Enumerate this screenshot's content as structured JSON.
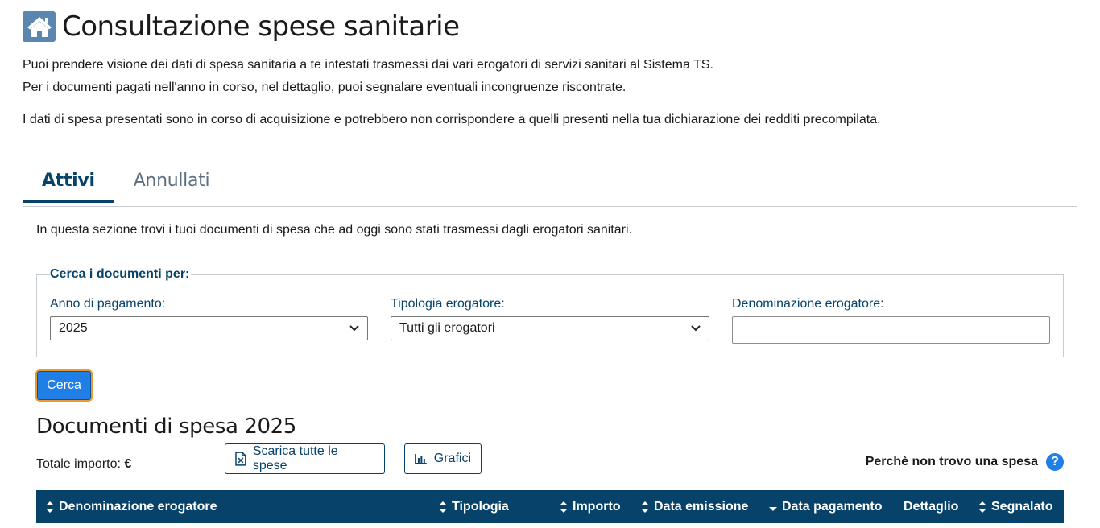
{
  "header": {
    "title": "Consultazione spese sanitarie",
    "intro_lines": [
      "Puoi prendere visione dei dati di spesa sanitaria a te intestati trasmessi dai vari erogatori di servizi sanitari al Sistema TS.",
      "Per i documenti pagati nell'anno in corso, nel dettaglio, puoi segnalare eventuali incongruenze riscontrate.",
      "I dati di spesa presentati sono in corso di acquisizione e potrebbero non corrispondere a quelli presenti nella tua dichiarazione dei redditi precompilata."
    ]
  },
  "tabs": [
    {
      "label": "Attivi",
      "active": true
    },
    {
      "label": "Annullati",
      "active": false
    }
  ],
  "panel": {
    "description": "In questa sezione trovi i tuoi documenti di spesa che ad oggi sono stati trasmessi dagli erogatori sanitari."
  },
  "search": {
    "legend": "Cerca i documenti per:",
    "anno_label": "Anno di pagamento:",
    "anno_value": "2025",
    "tipologia_label": "Tipologia erogatore:",
    "tipologia_value": "Tutti gli erogatori",
    "denominazione_label": "Denominazione erogatore:",
    "denominazione_value": "",
    "submit_label": "Cerca"
  },
  "results": {
    "title": "Documenti di spesa 2025",
    "totale_label": "Totale importo:",
    "totale_currency": "€",
    "download_label": "Scarica tutte le spese",
    "charts_label": "Grafici",
    "help_label": "Perchè non trovo una spesa",
    "help_icon": "?"
  },
  "table": {
    "columns": [
      {
        "label": "Denominazione erogatore",
        "sort": "both"
      },
      {
        "label": "Tipologia",
        "sort": "both"
      },
      {
        "label": "Importo",
        "sort": "both"
      },
      {
        "label": "Data emissione",
        "sort": "both"
      },
      {
        "label": "Data pagamento",
        "sort": "desc"
      },
      {
        "label": "Dettaglio",
        "sort": "none"
      },
      {
        "label": "Segnalato",
        "sort": "both"
      }
    ]
  },
  "colors": {
    "primary": "#06426a",
    "accent": "#1f7fe6",
    "home_icon_bg": "#5b86b0"
  }
}
